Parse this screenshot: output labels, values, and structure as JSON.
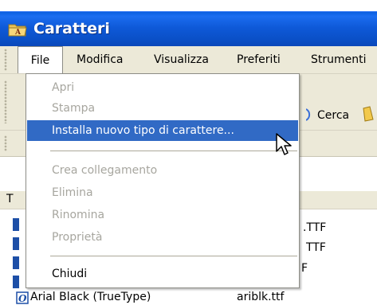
{
  "window": {
    "title": "Caratteri"
  },
  "menubar": {
    "items": [
      "File",
      "Modifica",
      "Visualizza",
      "Preferiti",
      "Strumenti"
    ]
  },
  "toolbar": {
    "search_label": "Cerca"
  },
  "file_menu": {
    "items": [
      {
        "label": "Apri",
        "enabled": false
      },
      {
        "label": "Stampa",
        "enabled": false
      },
      {
        "label": "Installa nuovo tipo di carattere...",
        "enabled": true,
        "selected": true
      },
      {
        "label": "Crea collegamento",
        "enabled": false
      },
      {
        "label": "Elimina",
        "enabled": false
      },
      {
        "label": "Rinomina",
        "enabled": false
      },
      {
        "label": "Proprietà",
        "enabled": false
      },
      {
        "label": "Chiudi",
        "enabled": true
      }
    ]
  },
  "file_list": {
    "header_first_letter": "T",
    "partial_rows": [
      ".TTF",
      "TTF",
      "F"
    ],
    "last_row": {
      "name": "Arial Black (TrueType)",
      "file": "ariblk.ttf"
    }
  },
  "colors": {
    "titlebar": "#0a55d4",
    "menu_highlight": "#316ac5",
    "menu_background": "#ece9d8"
  }
}
